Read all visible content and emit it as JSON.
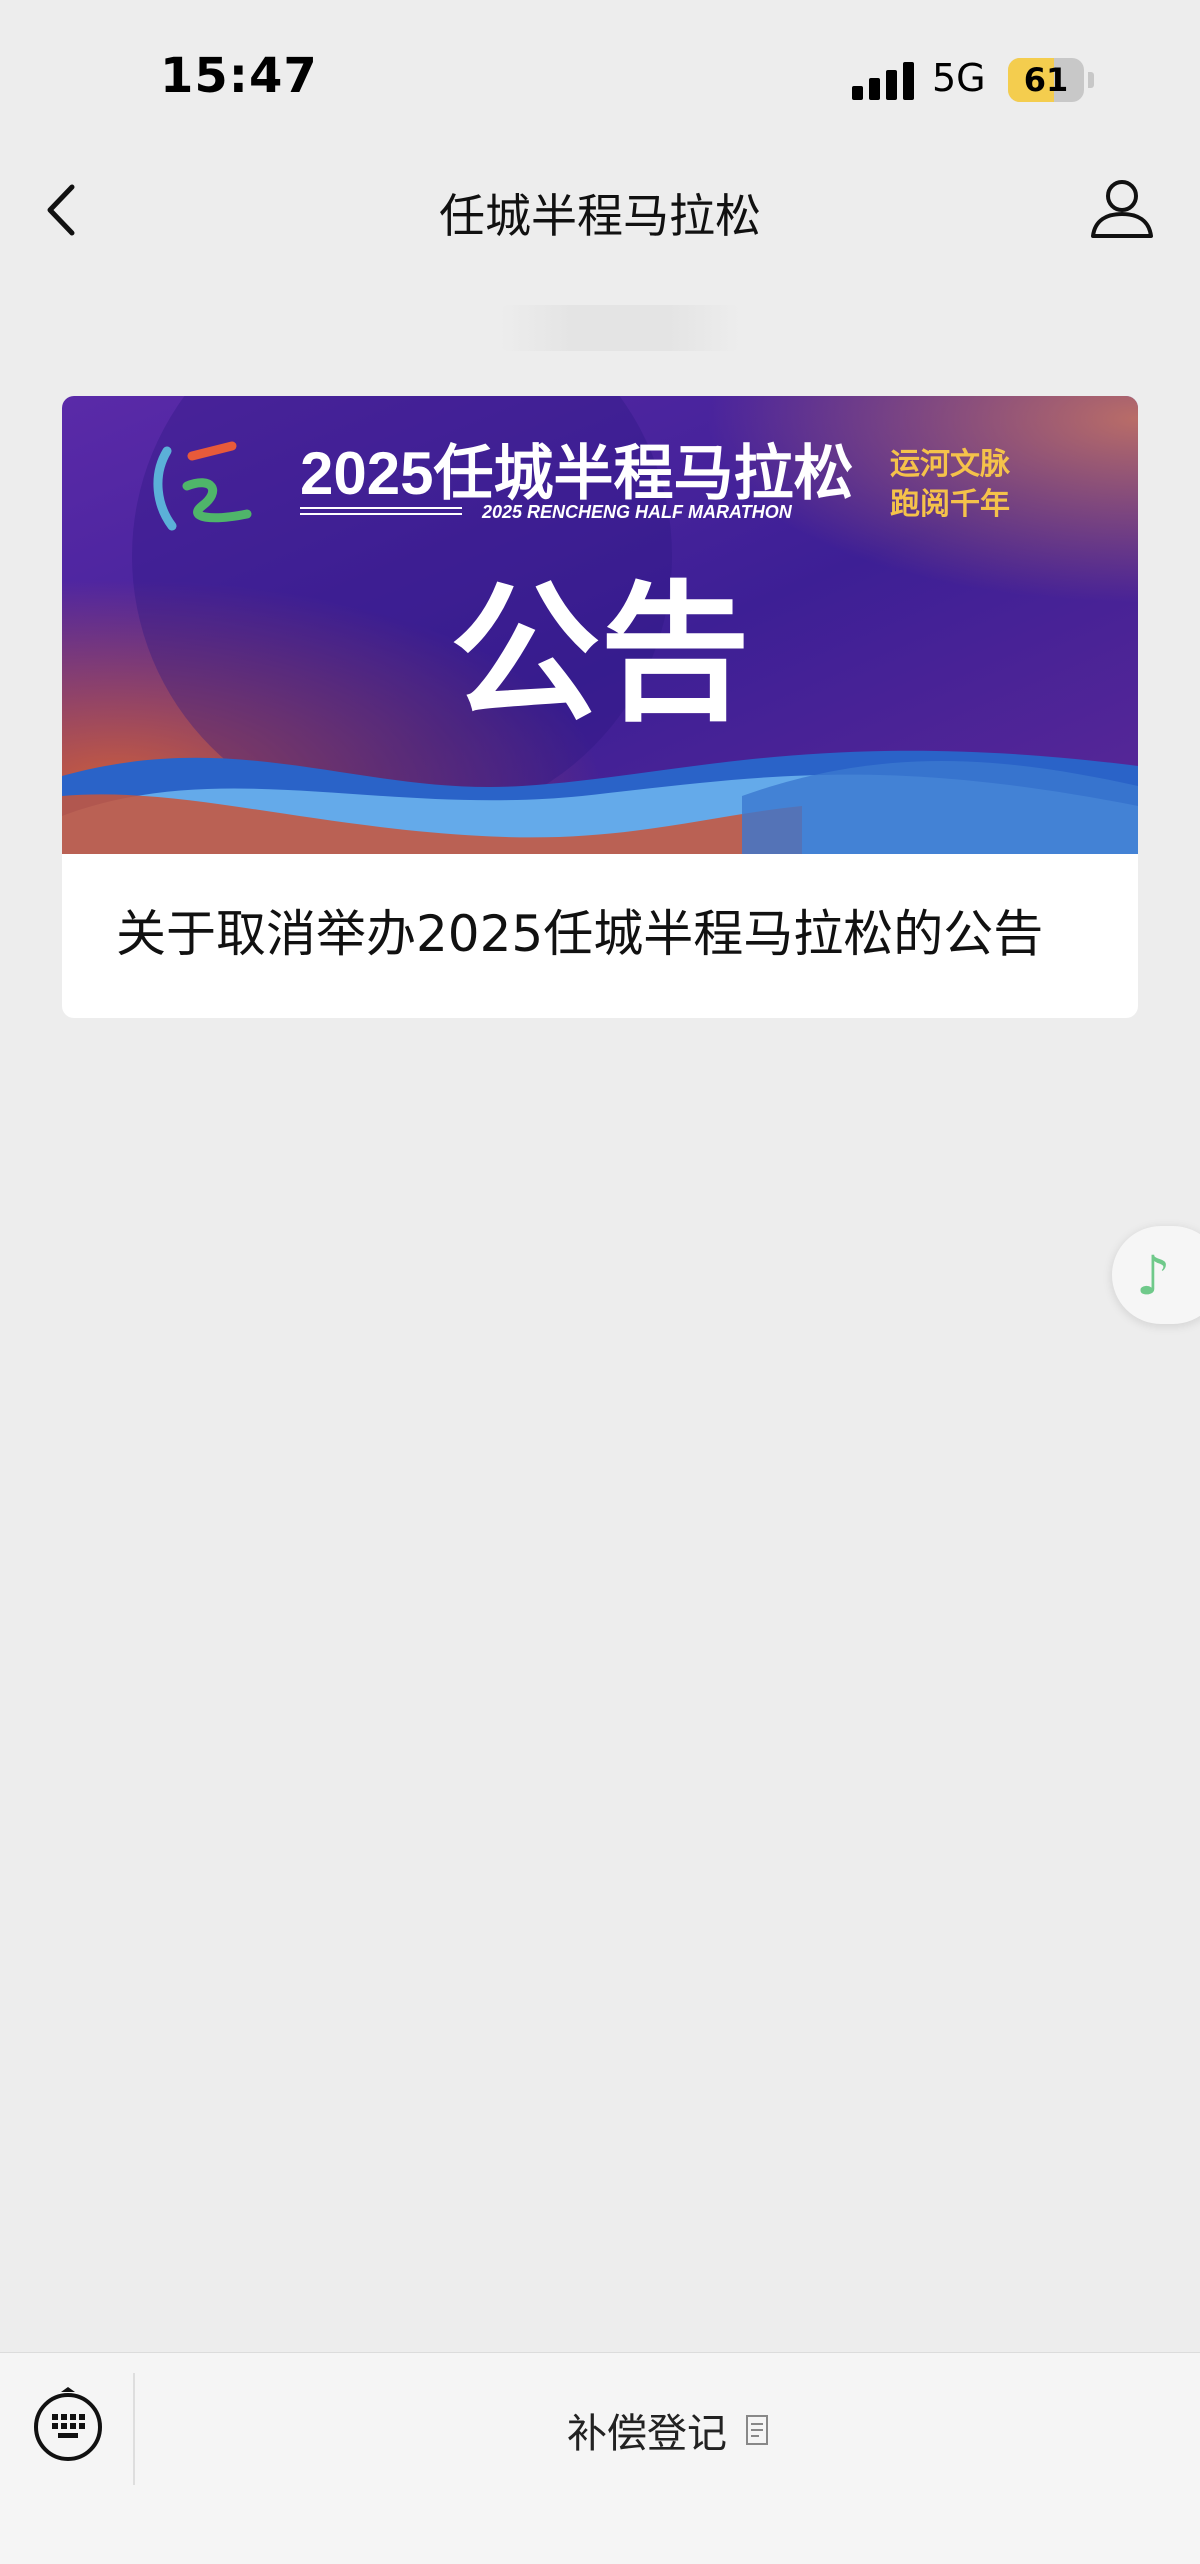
{
  "status_bar": {
    "time": "15:47",
    "network": "5G",
    "battery": "61",
    "battery_level": 0.61,
    "battery_color": "#f4cd4e"
  },
  "nav": {
    "back_icon": "chevron-left-icon",
    "title": "任城半程马拉松",
    "profile_icon": "person-icon"
  },
  "card": {
    "banner": {
      "year_title": "2025任城半程马拉松",
      "subtitle_en": "2025 RENCHENG HALF MARATHON",
      "slogan_line1": "运河文脉",
      "slogan_line2": "跑阅千年",
      "heading": "公告",
      "background_color": "#4a1f9e",
      "accent_color": "#f5c24a"
    },
    "title": "关于取消举办2025任城半程马拉松的公告"
  },
  "floating": {
    "music_icon": "music-note-icon",
    "music_color": "#6fc98a"
  },
  "bottom_menu": {
    "keyboard_icon": "keyboard-icon",
    "item_label": "补偿登记",
    "item_icon": "page-icon"
  }
}
